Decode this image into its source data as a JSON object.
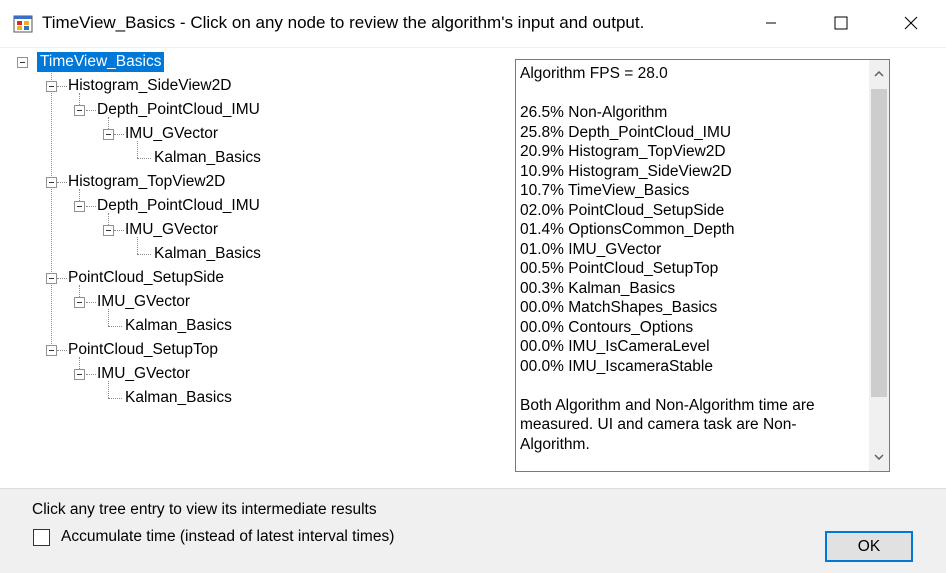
{
  "window": {
    "title": "TimeView_Basics - Click on any node to review the algorithm's input and output.",
    "icon": "app-window-icon"
  },
  "tree": {
    "root": "TimeView_Basics",
    "nodes": [
      "Histogram_SideView2D",
      "Depth_PointCloud_IMU",
      "IMU_GVector",
      "Kalman_Basics",
      "Histogram_TopView2D",
      "Depth_PointCloud_IMU",
      "IMU_GVector",
      "Kalman_Basics",
      "PointCloud_SetupSide",
      "IMU_GVector",
      "Kalman_Basics",
      "PointCloud_SetupTop",
      "IMU_GVector",
      "Kalman_Basics"
    ]
  },
  "results": {
    "fps_line": "Algorithm FPS = 28.0",
    "rows": [
      "26.5% Non-Algorithm",
      "25.8% Depth_PointCloud_IMU",
      "20.9% Histogram_TopView2D",
      "10.9% Histogram_SideView2D",
      "10.7% TimeView_Basics",
      "02.0% PointCloud_SetupSide",
      "01.4% OptionsCommon_Depth",
      "01.0% IMU_GVector",
      "00.5% PointCloud_SetupTop",
      "00.3% Kalman_Basics",
      "00.0% MatchShapes_Basics",
      "00.0% Contours_Options",
      "00.0% IMU_IsCameraLevel",
      "00.0% IMU_IscameraStable"
    ],
    "note_lines": [
      "Both Algorithm and Non-Algorithm time are",
      "measured.  UI and camera task are Non-",
      "Algorithm."
    ]
  },
  "footer": {
    "hint": "Click any tree entry to view its intermediate results",
    "checkbox_label": "Accumulate time (instead of latest interval times)",
    "checkbox_checked": false,
    "ok_label": "OK"
  },
  "colors": {
    "selection": "#0078d7",
    "dialog_bg": "#f0f0f0",
    "button_border": "#0078d7"
  }
}
